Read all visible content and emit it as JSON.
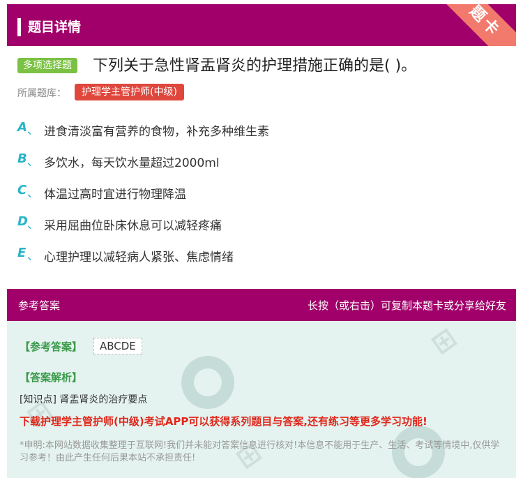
{
  "header": {
    "title": "题目详情",
    "corner_label": "题卡"
  },
  "question": {
    "type_tag": "多项选择题",
    "text": "下列关于急性肾盂肾炎的护理措施正确的是( )。",
    "library_label": "所属题库：",
    "library_name": "护理学主管护师(中级)"
  },
  "options": [
    {
      "letter": "A",
      "sep": "、",
      "text": "进食清淡富有营养的食物，补充多种维生素"
    },
    {
      "letter": "B",
      "sep": "、",
      "text": "多饮水，每天饮水量超过2000ml"
    },
    {
      "letter": "C",
      "sep": "、",
      "text": "体温过高时宜进行物理降温"
    },
    {
      "letter": "D",
      "sep": "、",
      "text": "采用屈曲位卧床休息可以减轻疼痛"
    },
    {
      "letter": "E",
      "sep": "、",
      "text": "心理护理以减轻病人紧张、焦虑情绪"
    }
  ],
  "answer_section": {
    "title": "参考答案",
    "hint": "长按（或右击）可复制本题卡或分享给好友",
    "answer_label": "【参考答案】",
    "answer_value": "ABCDE",
    "analysis_label": "【答案解析】",
    "knowledge_point": "[知识点] 肾盂肾炎的治疗要点",
    "promo": "下载护理学主管护师(中级)考试APP可以获得系列题目与答案,还有练习等更多学习功能!",
    "disclaimer": "*申明:本网站数据收集整理于互联网!我们并未能对答案信息进行核对!本信息不能用于生产、生活、考试等情境中,仅供学习参考！由此产生任何后果本站不承担责任!"
  },
  "colors": {
    "brand": "#a1006a",
    "corner": "#f27a6d",
    "type_tag": "#7bc144",
    "library_tag": "#e0473c",
    "option_letter": "#29b4c9",
    "answer_bg": "#e4f3ef",
    "answer_label": "#3a9a4a",
    "promo": "#e0261a"
  }
}
